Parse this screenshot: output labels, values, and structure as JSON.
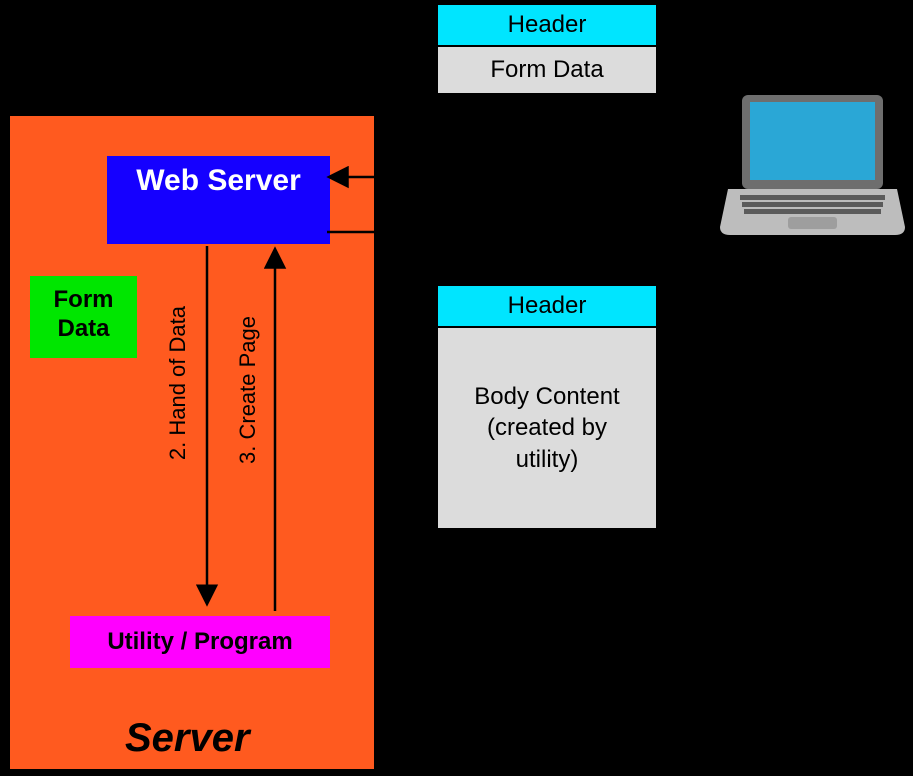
{
  "server": {
    "title": "Server",
    "webserver": "Web Server",
    "formdata": "Form Data",
    "utility": "Utility / Program",
    "step2": "2. Hand of Data",
    "step3": "3. Create Page"
  },
  "request_packet": {
    "header": "Header",
    "body": "Form Data"
  },
  "response_packet": {
    "header": "Header",
    "body": "Body Content (created by utility)"
  },
  "laptop_name": "client-laptop"
}
